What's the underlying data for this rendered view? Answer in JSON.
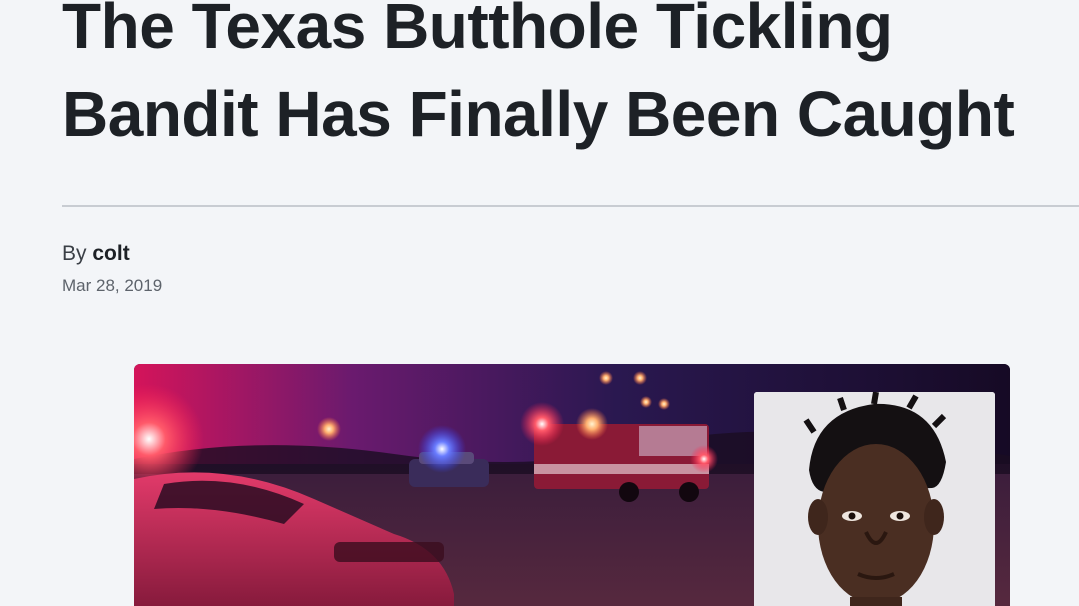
{
  "article": {
    "title": "The Texas Butthole Tickling Bandit Has Finally Been Caught",
    "byline_prefix": "By",
    "author": "colt",
    "date": "Mar 28, 2019"
  },
  "icons": {
    "hero_image": "police-scene-photo",
    "mugshot_image": "mugshot-photo"
  },
  "colors": {
    "background": "#f3f5f8",
    "headline": "#1d2126",
    "divider": "#c8ccd2",
    "meta": "#5d636b"
  }
}
